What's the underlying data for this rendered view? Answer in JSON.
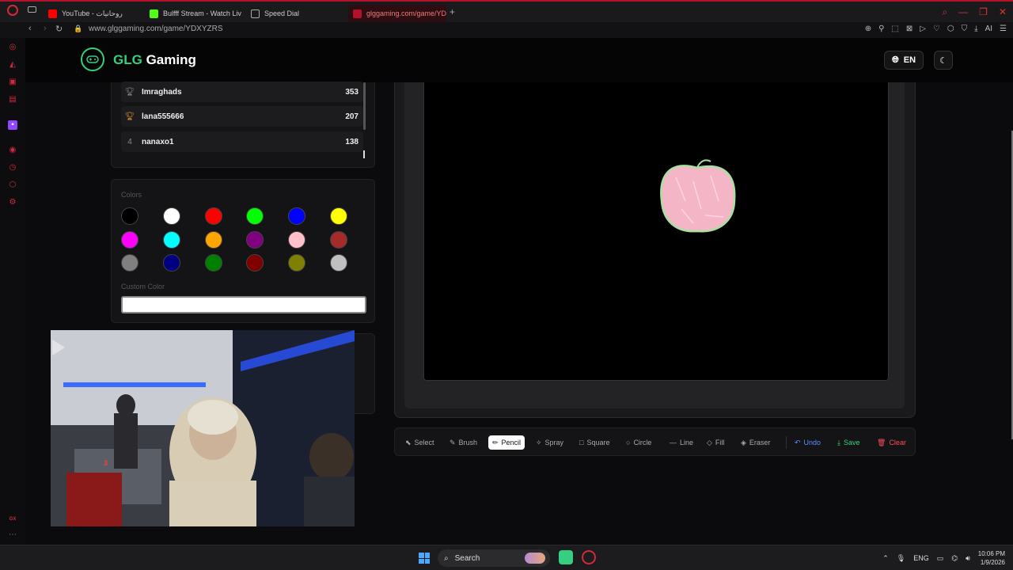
{
  "browser": {
    "tabs": [
      {
        "title": "YouTube - روحانيات",
        "color": "#ff0000"
      },
      {
        "title": "Bulfff Stream - Watch Live",
        "color": "#53fc18"
      },
      {
        "title": "Speed Dial",
        "color": "#888888"
      },
      {
        "title": "glggaming.com/game/YDX",
        "color": "#b3122a"
      }
    ],
    "new_tab": "+",
    "url": "www.glggaming.com/game/YDXYZRS",
    "ai_label": "AI"
  },
  "header": {
    "logo_accent": "GLG",
    "logo_rest": " Gaming",
    "lang": "EN"
  },
  "leaderboard": {
    "rows": [
      {
        "rank_icon": "trophy-silver-icon",
        "rank": "",
        "name": "Imraghads",
        "score": "353"
      },
      {
        "rank_icon": "trophy-bronze-icon",
        "rank": "",
        "name": "lana555666",
        "score": "207"
      },
      {
        "rank_icon": "",
        "rank": "4",
        "name": "nanaxo1",
        "score": "138"
      }
    ]
  },
  "colors": {
    "label": "Colors",
    "custom_label": "Custom Color",
    "swatches": [
      "#000000",
      "#ffffff",
      "#ff0000",
      "#00ff00",
      "#0000ff",
      "#ffff00",
      "#ff00ff",
      "#00ffff",
      "#ffa500",
      "#800080",
      "#ffc0cb",
      "#a52a2a",
      "#808080",
      "#000080",
      "#008000",
      "#800000",
      "#808000",
      "#c0c0c0"
    ],
    "custom_value": "#ffffff"
  },
  "webcam": {
    "overlay_digit": "3"
  },
  "toolbar": {
    "tools": [
      {
        "label": "Select",
        "icon": "cursor-icon"
      },
      {
        "label": "Brush",
        "icon": "brush-icon"
      },
      {
        "label": "Pencil",
        "icon": "pencil-icon",
        "active": true
      },
      {
        "label": "Spray",
        "icon": "spray-icon"
      },
      {
        "label": "Square",
        "icon": "square-icon"
      },
      {
        "label": "Circle",
        "icon": "circle-icon"
      },
      {
        "label": "Line",
        "icon": "line-icon"
      },
      {
        "label": "Fill",
        "icon": "fill-icon"
      },
      {
        "label": "Eraser",
        "icon": "eraser-icon"
      }
    ],
    "undo": "Undo",
    "save": "Save",
    "clear": "Clear"
  },
  "taskbar": {
    "search": "Search",
    "lang": "ENG",
    "time": "10:06 PM",
    "date": "1/9/2026"
  },
  "sidebar_footer": "GX"
}
